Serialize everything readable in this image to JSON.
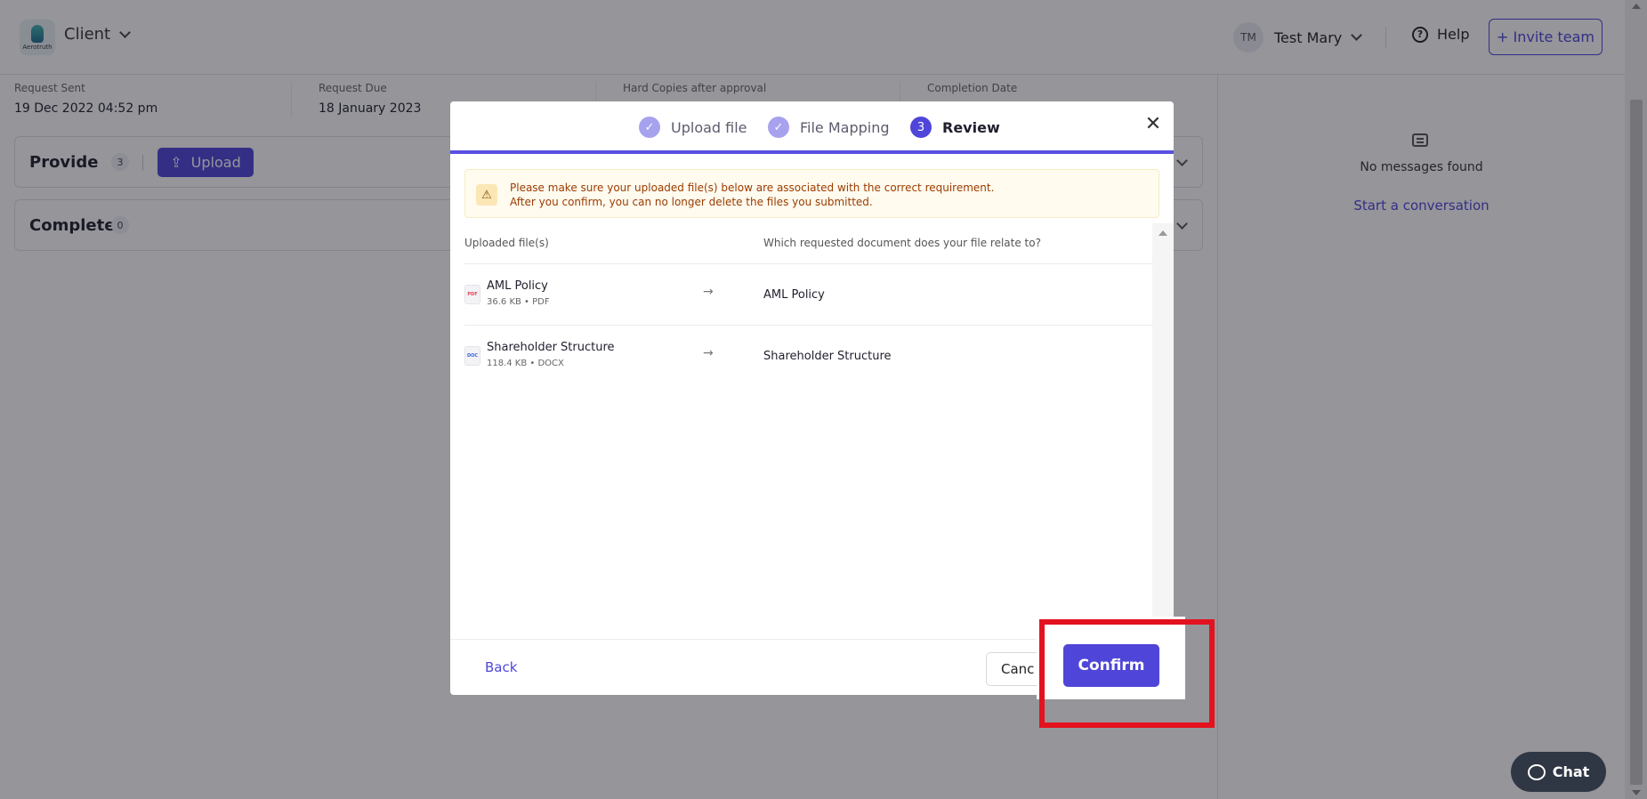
{
  "header": {
    "logo_text": "Aerotruth",
    "client_label": "Client",
    "user_initials": "TM",
    "user_name": "Test Mary",
    "help_label": "Help",
    "invite_label": "+ Invite team"
  },
  "info": [
    {
      "label": "Request Sent",
      "value": "19 Dec 2022 04:52 pm"
    },
    {
      "label": "Request Due",
      "value": "18 January 2023"
    },
    {
      "label": "Hard Copies after approval",
      "value": ""
    },
    {
      "label": "Completion Date",
      "value": ""
    }
  ],
  "sections": {
    "provide": {
      "title": "Provide",
      "count": "3",
      "upload_label": "Upload"
    },
    "complete": {
      "title": "Complete",
      "count": "0"
    }
  },
  "messages": {
    "empty_text": "No messages found",
    "start_link": "Start a conversation"
  },
  "modal": {
    "steps": [
      {
        "number": "✓",
        "label": "Upload file",
        "state": "done"
      },
      {
        "number": "✓",
        "label": "File Mapping",
        "state": "done"
      },
      {
        "number": "3",
        "label": "Review",
        "state": "active"
      }
    ],
    "warning": {
      "line1": "Please make sure your uploaded file(s) below are associated with the correct requirement.",
      "line2": "After you confirm, you can no longer delete the files you submitted."
    },
    "table": {
      "col_uploaded": "Uploaded file(s)",
      "col_requested": "Which requested document does your file relate to?",
      "rows": [
        {
          "file_name": "AML Policy",
          "meta": "36.6 KB • PDF",
          "icon_text": "PDF",
          "icon_color": "#e0455a",
          "target": "AML Policy"
        },
        {
          "file_name": "Shareholder Structure",
          "meta": "118.4 KB • DOCX",
          "icon_text": "DOC",
          "icon_color": "#3a63d6",
          "target": "Shareholder Structure"
        }
      ]
    },
    "back_label": "Back",
    "cancel_label": "Canc",
    "confirm_label": "Confirm"
  },
  "chat_label": "Chat",
  "colors": {
    "accent": "#4f46d9",
    "highlight": "#e3121f",
    "warning_text": "#9b3b00"
  }
}
